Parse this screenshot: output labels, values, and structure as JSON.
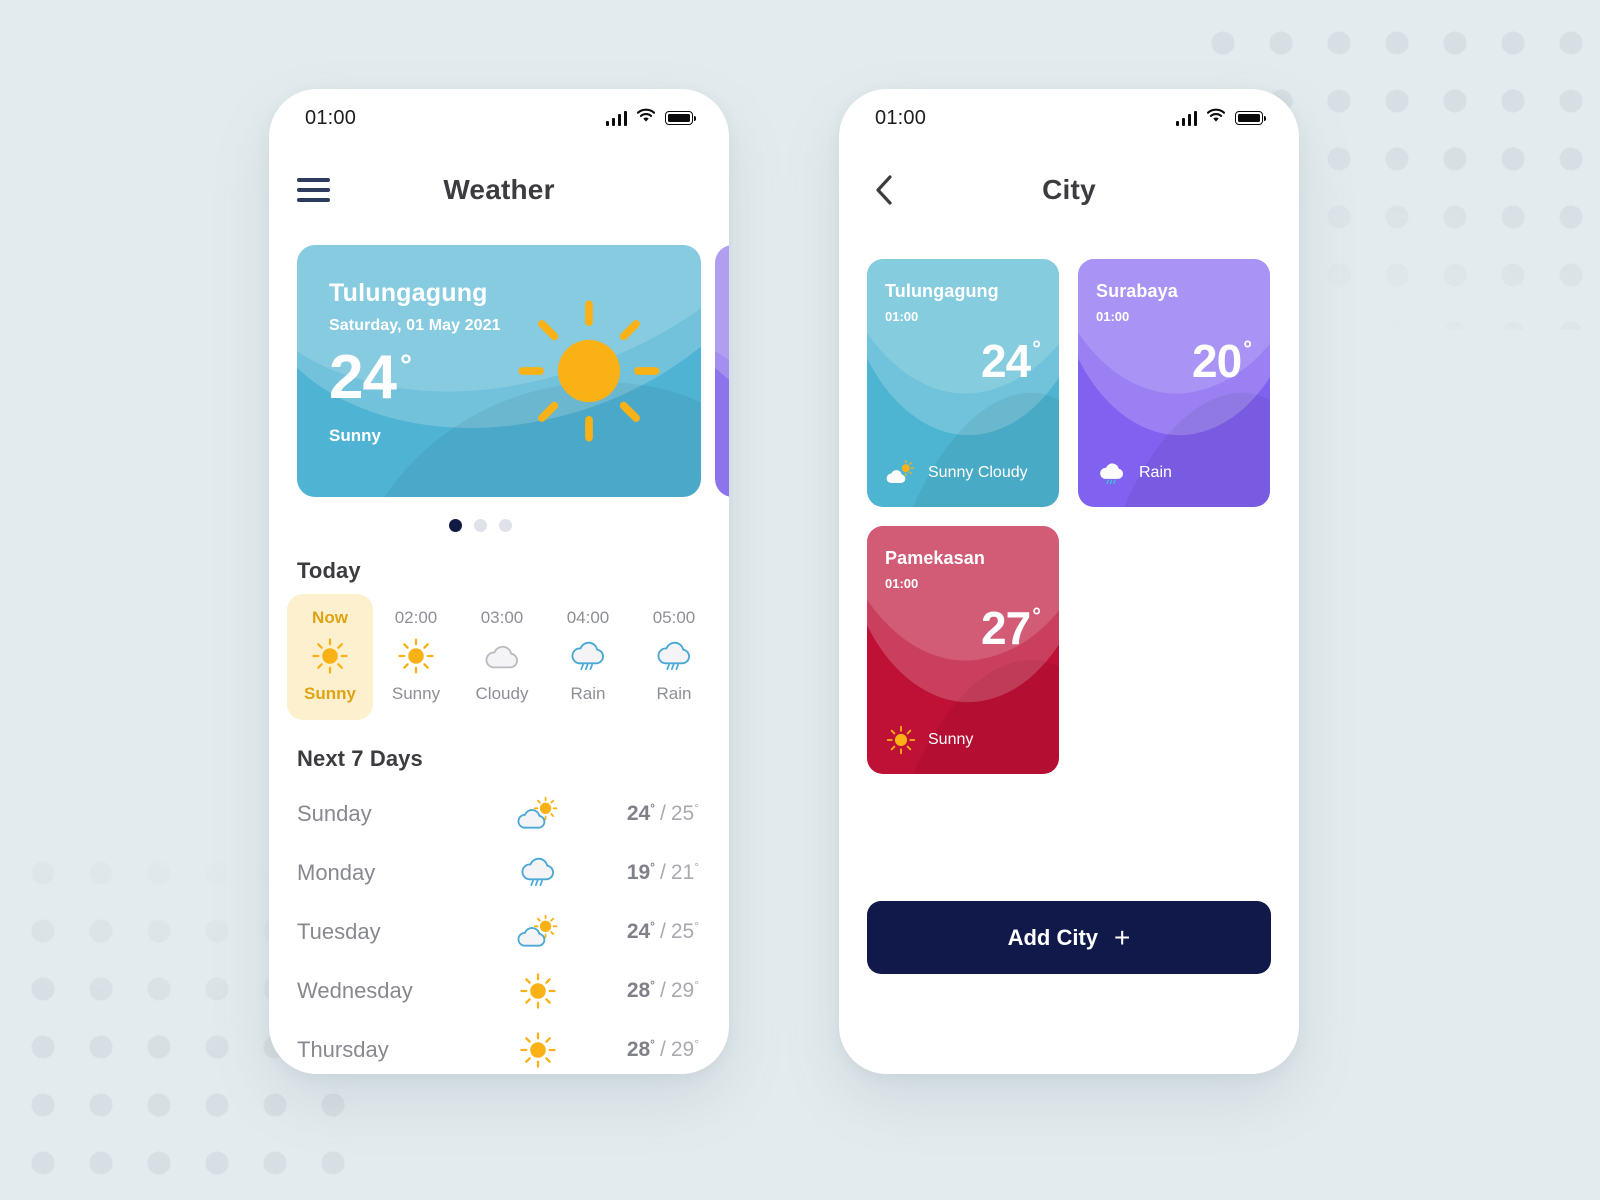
{
  "theme": {
    "page_background": "#e3ebee",
    "dot_pattern": "#d6dfe3",
    "navy": "#10194a",
    "teal": "#4db4d1",
    "purple": "#8161ef",
    "crimson": "#bf1036",
    "amber": "#f5ab16",
    "highlight_bg": "#fdf0cf",
    "muted_text": "#8d8f96"
  },
  "weather_screen": {
    "status_bar": {
      "time": "01:00",
      "signal_icon": "signal-bars-icon",
      "wifi_icon": "wifi-icon",
      "battery_icon": "battery-full-icon"
    },
    "header": {
      "menu_icon": "hamburger-menu-icon",
      "title": "Weather"
    },
    "carousel": {
      "cards": [
        {
          "city": "Tulungagung",
          "date": "Saturday, 01 May 2021",
          "temperature": "24",
          "degree": "°",
          "condition": "Sunny",
          "icon": "sun-icon",
          "color": "#4fb3d4"
        },
        {
          "city": "",
          "date": "",
          "temperature": "",
          "degree": "",
          "condition": "",
          "icon": "",
          "color": "#8c74ec"
        }
      ],
      "pagination": {
        "count": 3,
        "active_index": 0
      }
    },
    "today": {
      "title": "Today",
      "hours": [
        {
          "time": "Now",
          "icon": "sun-icon",
          "condition": "Sunny",
          "active": true
        },
        {
          "time": "02:00",
          "icon": "sun-icon",
          "condition": "Sunny",
          "active": false
        },
        {
          "time": "03:00",
          "icon": "cloud-icon",
          "condition": "Cloudy",
          "active": false
        },
        {
          "time": "04:00",
          "icon": "rain-icon",
          "condition": "Rain",
          "active": false
        },
        {
          "time": "05:00",
          "icon": "rain-icon",
          "condition": "Rain",
          "active": false
        }
      ]
    },
    "next_seven_days": {
      "title": "Next 7 Days",
      "rows": [
        {
          "day": "Sunday",
          "icon": "sun-behind-cloud-icon",
          "high": "24",
          "low": "25",
          "degree": "°",
          "separator": "/"
        },
        {
          "day": "Monday",
          "icon": "rain-icon",
          "high": "19",
          "low": "21",
          "degree": "°",
          "separator": "/"
        },
        {
          "day": "Tuesday",
          "icon": "sun-behind-cloud-icon",
          "high": "24",
          "low": "25",
          "degree": "°",
          "separator": "/"
        },
        {
          "day": "Wednesday",
          "icon": "sun-icon",
          "high": "28",
          "low": "29",
          "degree": "°",
          "separator": "/"
        },
        {
          "day": "Thursday",
          "icon": "sun-icon",
          "high": "28",
          "low": "29",
          "degree": "°",
          "separator": "/"
        }
      ]
    }
  },
  "city_screen": {
    "status_bar": {
      "time": "01:00",
      "signal_icon": "signal-bars-icon",
      "wifi_icon": "wifi-icon",
      "battery_icon": "battery-full-icon"
    },
    "header": {
      "back_icon": "chevron-left-icon",
      "title": "City"
    },
    "cities": [
      {
        "name": "Tulungagung",
        "time": "01:00",
        "temperature": "24",
        "degree": "°",
        "condition": "Sunny Cloudy",
        "icon": "sun-behind-cloud-icon",
        "color": "#4db4d1"
      },
      {
        "name": "Surabaya",
        "time": "01:00",
        "temperature": "20",
        "degree": "°",
        "condition": "Rain",
        "icon": "rain-icon",
        "color": "#8161ef"
      },
      {
        "name": "Pamekasan",
        "time": "01:00",
        "temperature": "27",
        "degree": "°",
        "condition": "Sunny",
        "icon": "sun-icon",
        "color": "#bf1036"
      }
    ],
    "add_city_button": {
      "label": "Add City",
      "plus_icon": "plus-icon",
      "plus_glyph": "+"
    }
  }
}
